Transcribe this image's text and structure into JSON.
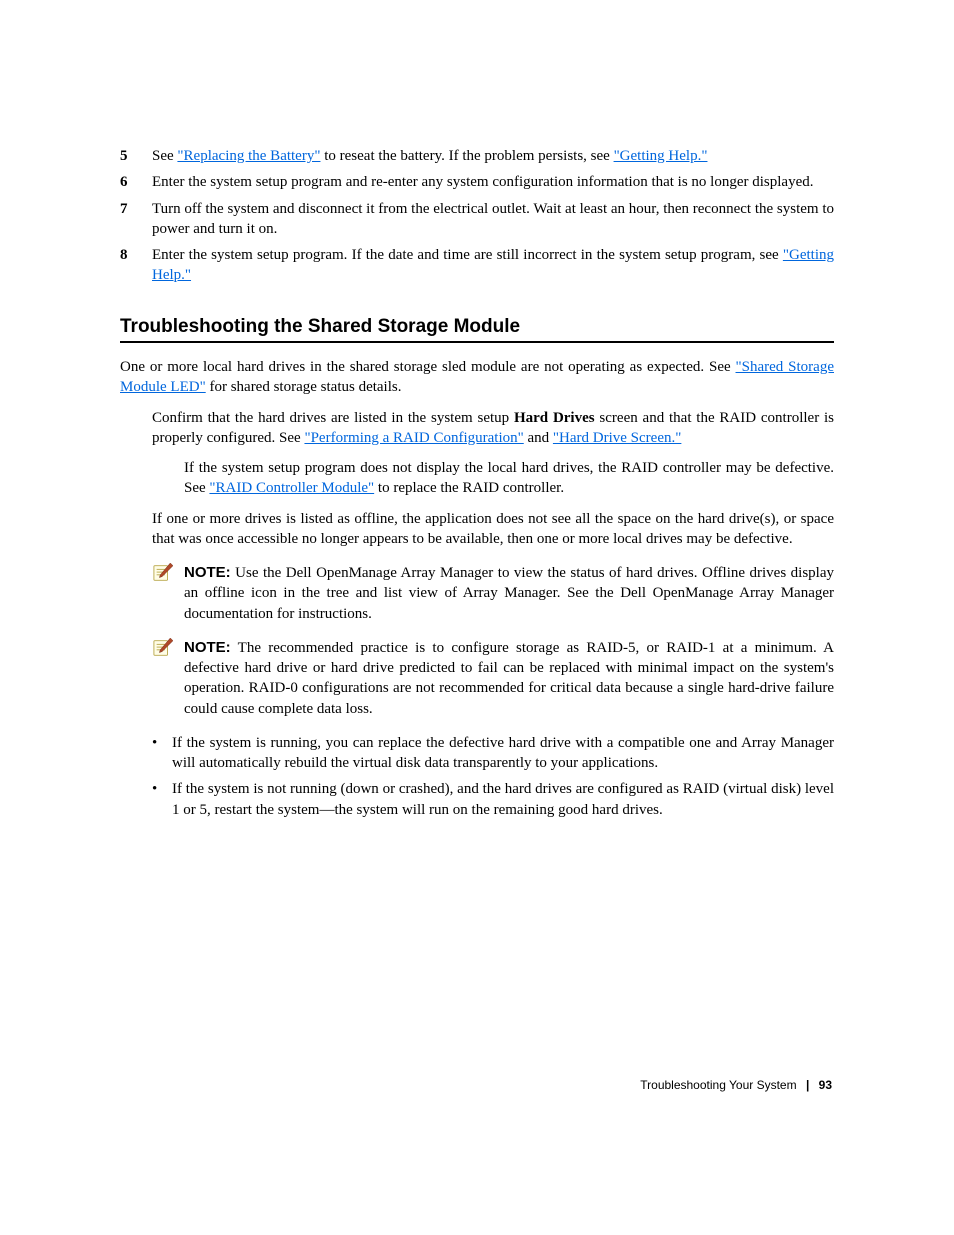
{
  "intro": {
    "step5": {
      "num": "5",
      "pre": "See ",
      "link": "\"Replacing the Battery\"",
      "post": " to reseat the battery. If the problem persists, see ",
      "link2": "\"Getting Help.\""
    },
    "step6": {
      "num": "6",
      "text": "Enter the system setup program and re-enter any system configuration information that is no longer displayed."
    },
    "step7": {
      "num": "7",
      "text": "Turn off the system and disconnect it from the electrical outlet. Wait at least an hour, then reconnect the system to power and turn it on."
    },
    "step8": {
      "num": "8",
      "pre": "Enter the system setup program. If the date and time are still incorrect in the system setup program, see ",
      "link": "\"Getting Help.\""
    }
  },
  "heading": "Troubleshooting the Shared Storage Module",
  "body": {
    "p1": {
      "pre": "One or more local hard drives in the shared storage sled module are not operating as expected. See ",
      "link": "\"Shared Storage Module LED\"",
      "post": " for shared storage status details."
    },
    "p2": {
      "pre": "Confirm that the hard drives are listed in the system setup ",
      "bold": "Hard Drives",
      "mid": " screen and that the RAID controller is properly configured. See ",
      "link": "\"Performing a RAID Configuration\"",
      "post": " and ",
      "link2": "\"Hard Drive Screen.\""
    },
    "p3": {
      "pre": "If the system setup program does not display the local hard drives, the RAID controller may be defective. See ",
      "link": "\"RAID Controller Module\"",
      "post": " to replace the RAID controller."
    },
    "p4": "If one or more drives is listed as offline, the application does not see all the space on the hard drive(s), or space that was once accessible no longer appears to be available, then one or more local drives may be defective."
  },
  "note1": {
    "label": "NOTE:",
    "text": "Use the Dell OpenManage Array Manager to view the status of hard drives. Offline drives display an offline icon in the tree and list view of Array Manager. See the Dell OpenManage Array Manager documentation for instructions."
  },
  "note2": {
    "label": "NOTE:",
    "text": "The recommended practice is to configure storage as RAID-5, or RAID-1 at a minimum. A defective hard drive or hard drive predicted to fail can be replaced with minimal impact on the system's operation. RAID-0 configurations are not recommended for critical data because a single hard-drive failure could cause complete data loss."
  },
  "list": {
    "bullet": "•",
    "item1": "If the system is running, you can replace the defective hard drive with a compatible one and Array Manager will automatically rebuild the virtual disk data transparently to your applications.",
    "item2": "If the system is not running (down or crashed), and the hard drives are configured as RAID (virtual disk) level 1 or 5, restart the system—the system will run on the remaining good hard drives."
  },
  "footer": {
    "section": "Troubleshooting Your System",
    "page": "93"
  }
}
